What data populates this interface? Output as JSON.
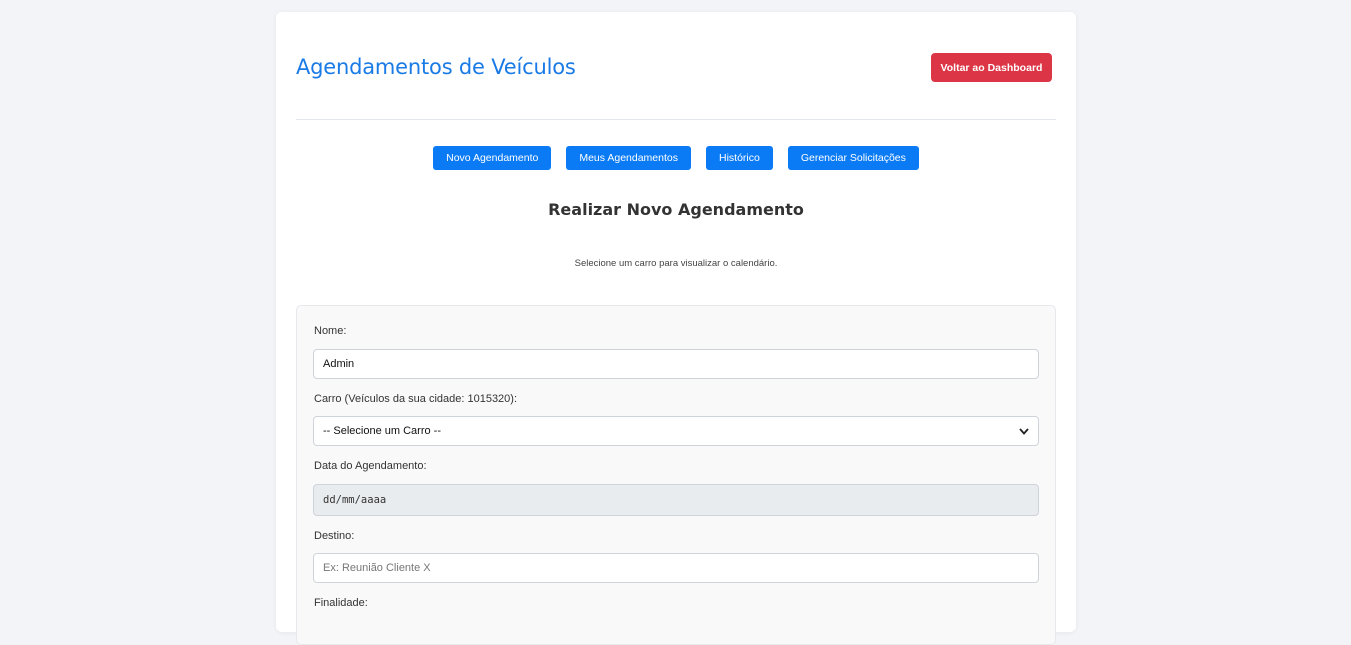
{
  "header": {
    "title": "Agendamentos de Veículos",
    "back_button": "Voltar ao Dashboard"
  },
  "nav": {
    "items": [
      {
        "label": "Novo Agendamento"
      },
      {
        "label": "Meus Agendamentos"
      },
      {
        "label": "Histórico"
      },
      {
        "label": "Gerenciar Solicitações"
      }
    ]
  },
  "section": {
    "title": "Realizar Novo Agendamento",
    "hint": "Selecione um carro para visualizar o calendário."
  },
  "form": {
    "nome_label": "Nome:",
    "nome_value": "Admin",
    "carro_label": "Carro (Veículos da sua cidade: 1015320):",
    "carro_selected": "-- Selecione um Carro --",
    "data_label": "Data do Agendamento:",
    "data_placeholder": "dd/mm/aaaa",
    "destino_label": "Destino:",
    "destino_placeholder": "Ex: Reunião Cliente X",
    "finalidade_label": "Finalidade:"
  },
  "colors": {
    "primary": "#0b7bf5",
    "title": "#1a7be6",
    "danger": "#dc3545",
    "background": "#f2f4f7"
  }
}
